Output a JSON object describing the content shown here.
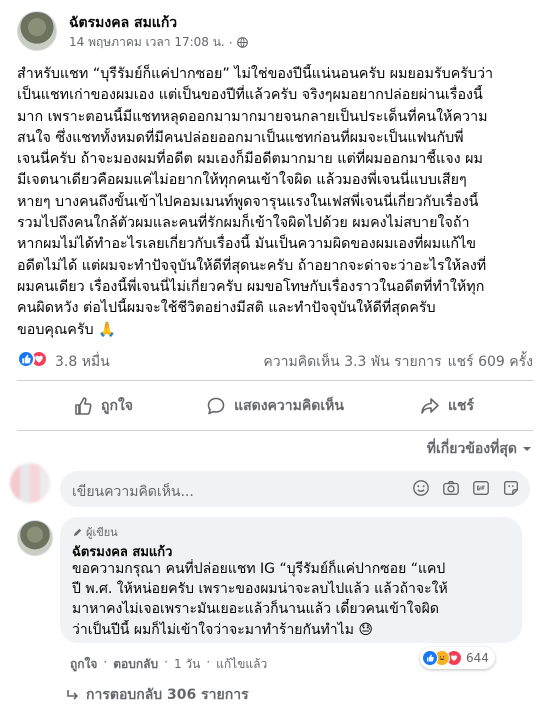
{
  "post": {
    "author": "ฉัตรมงคล สมแก้ว",
    "timestamp": "14 พฤษภาคม เวลา 17:08 น.",
    "privacy_icon": "globe-icon",
    "body_lines": [
      "สำหรับแชท “บุรีรัมย์ก็แค่ปากซอย” ไม่ใช่ของปีนี้แน่นอนครับ ผมยอมรับครับว่า",
      "เป็นแชทเก่าของผมเอง แต่เป็นของปีที่แล้วครับ จริงๆผมอยากปล่อยผ่านเรื่องนี้",
      "มาก เพราะตอนนี้มีแชทหลุดออกมามากมายจนกลายเป็นประเด็นที่คนให้ความ",
      "สนใจ ซึ่งแชททั้งหมดที่มีคนปล่อยออกมาเป็นแชทก่อนที่ผมจะเป็นแฟนกับพี่",
      "เจนนี่ครับ ถ้าจะมองผมที่อดีต ผมเองก็มีอดีตมากมาย แต่ที่ผมออกมาชี้แจง ผม",
      "มีเจตนาเดียวคือผมแค่ไม่อยากให้ทุกคนเข้าใจผิด แล้วมองพี่เจนนี่แบบเสียๆ",
      "หายๆ บางคนถึงขั้นเข้าไปคอมเมนท์พูดจารุนแรงในเฟสพี่เจนนี่เกี่ยวกับเรื่องนี้",
      "รวมไปถึงคนใกล้ตัวผมและคนที่รักผมก็เข้าใจผิดไปด้วย ผมคงไม่สบายใจถ้า",
      "หากผมไม่ได้ทำอะไรเลยเกี่ยวกับเรื่องนี้ มันเป็นความผิดของผมเองที่ผมแก้ไข",
      "อดีตไม่ได้ แต่ผมจะทำปัจจุบันให้ดีที่สุดนะครับ ถ้าอยากจะด่าจะว่าอะไรให้ลงที่",
      "ผมคนเดียว เรื่องนี้พี่เจนนี่ไม่เกี่ยวครับ ผมขอโทษกับเรื่องราวในอดีตที่ทำให้ทุก",
      "คนผิดหวัง ต่อไปนี้ผมจะใช้ชีวิตอย่างมีสติ และทำปัจจุบันให้ดีที่สุดครับ",
      "ขอบคุณครับ 🙏"
    ],
    "reactions_count": "3.8 หมื่น",
    "comments_count": "ความคิดเห็น 3.3 พัน รายการ",
    "shares_count": "แชร์ 609 ครั้ง",
    "actions": {
      "like": "ถูกใจ",
      "comment": "แสดงความคิดเห็น",
      "share": "แชร์"
    },
    "comment_filter": "ที่เกี่ยวข้องที่สุด",
    "comment_placeholder": "เขียนความคิดเห็น..."
  },
  "comment": {
    "badge": "ผู้เขียน",
    "author": "ฉัตรมงคล สมแก้ว",
    "text_lines": [
      "ขอความกรุณา คนที่ปล่อยแชท IG “บุรีรัมย์ก็แค่ปากซอย “แคป",
      "ปี พ.ศ. ให้หน่อยครับ เพราะของผมน่าจะลบไปแล้ว แล้วถ้าจะให้",
      "มาหาคงไม่เจอเพราะมันเยอะแล้วก็นานแล้ว เดี๋ยวคนเข้าใจผิด",
      "ว่าเป็นปีนี้ ผมก็ไม่เข้าใจว่าจะมาทำร้ายกันทำไม 😓"
    ],
    "reaction_count": "644",
    "like": "ถูกใจ",
    "reply": "ตอบกลับ",
    "age": "1 วัน",
    "edited": "แก้ไขแล้ว",
    "replies": "การตอบกลับ 306 รายการ"
  },
  "colors": {
    "text": "#050505",
    "secondary": "#65676b",
    "like_blue": "#1877f2",
    "love_red": "#f33e58",
    "haha_yellow": "#f7b125",
    "divider": "#ced0d4",
    "input_bg": "#f0f2f5"
  }
}
